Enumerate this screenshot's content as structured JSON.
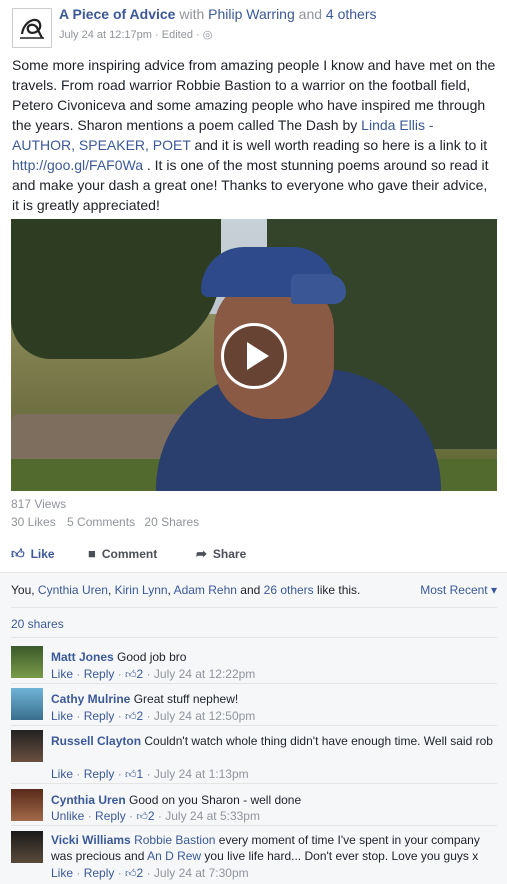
{
  "header": {
    "page_name": "A Piece of Advice",
    "with_text": "with",
    "tagged_person": "Philip Warring",
    "and_text": "and",
    "others": "4 others",
    "timestamp": "July 24 at 12:17pm",
    "edited": "Edited",
    "separator": "·"
  },
  "post": {
    "text_parts": [
      "Some more inspiring advice from amazing people I know and have met on the travels. From road warrior Robbie Bastion to a warrior on the football field, Petero Civoniceva and some amazing people who have inspired me through the years. Sharon mentions a poem called The Dash by ",
      "Linda Ellis - AUTHOR, SPEAKER, POET",
      " and it is well worth reading so here is a link to it ",
      "http://goo.gl/FAF0Wa",
      " . It is one of the most stunning poems around so read it and make your dash a great one! Thanks to everyone who gave their advice, it is greatly appreciated!"
    ]
  },
  "video": {
    "views": "817 Views",
    "likes": "30 Likes",
    "comments": "5 Comments",
    "shares": "20 Shares"
  },
  "actions": {
    "like": "Like",
    "comment": "Comment",
    "share": "Share"
  },
  "feedback": {
    "you": "You, ",
    "liker1": "Cynthia Uren",
    "comma1": ", ",
    "liker2": "Kirin Lynn",
    "comma2": ", ",
    "liker3": "Adam Rehn",
    "and": " and ",
    "others": "26 others",
    "like_this": " like this.",
    "sort": "Most Recent",
    "shares": "20 shares"
  },
  "comments": [
    {
      "author": "Matt Jones",
      "text": "Good job bro",
      "like": "Like",
      "reply": "Reply",
      "likes": "2",
      "time": "July 24 at 12:22pm"
    },
    {
      "author": "Cathy Mulrine",
      "text": "Great stuff nephew!",
      "like": "Like",
      "reply": "Reply",
      "likes": "2",
      "time": "July 24 at 12:50pm"
    },
    {
      "author": "Russell Clayton",
      "text": "Couldn't watch whole thing didn't have enough time. Well said rob",
      "like": "Like",
      "reply": "Reply",
      "likes": "1",
      "time": "July 24 at 1:13pm"
    },
    {
      "author": "Cynthia Uren",
      "text": "Good on you Sharon - well done",
      "like": "Unlike",
      "reply": "Reply",
      "likes": "2",
      "time": "July 24 at 5:33pm"
    },
    {
      "author": "Vicki Williams",
      "mention1": "Robbie Bastion",
      "text1": " every moment of time I've spent in your company was precious and ",
      "mention2": "An D Rew",
      "text2": " you live life hard... Don't ever stop. Love you guys x",
      "like": "Like",
      "reply": "Reply",
      "likes": "2",
      "time": "July 24 at 7:30pm"
    }
  ],
  "colors": {
    "link": "#3b5998",
    "muted": "#90949c",
    "feedback_bg": "#f6f7f9"
  },
  "icons": {
    "globe": "globe-icon",
    "like": "thumbs-up-icon",
    "comment": "speech-bubble-icon",
    "share": "share-arrow-icon",
    "play": "play-icon"
  }
}
